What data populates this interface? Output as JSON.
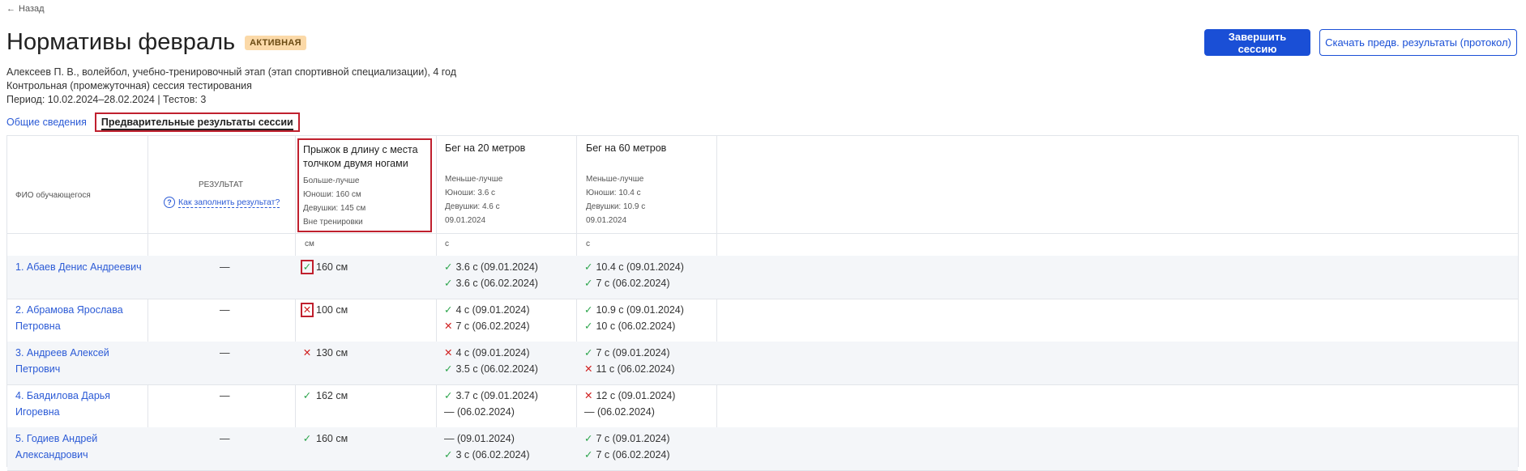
{
  "back": {
    "label": "Назад",
    "icon": "arrow-left-icon"
  },
  "page": {
    "title": "Нормативы февраль",
    "status": "АКТИВНАЯ"
  },
  "actions": {
    "finish": "Завершить сессию",
    "download": "Скачать предв. результаты (протокол)"
  },
  "info": {
    "line1": "Алексеев П. В., волейбол, учебно-тренировочный этап (этап спортивной специализации), 4 год",
    "line2": "Контрольная (промежуточная) сессия тестирования",
    "line3": "Период: 10.02.2024–28.02.2024 | Тестов: 3"
  },
  "tabs": {
    "general": "Общие сведения",
    "results": "Предварительные результаты сессии"
  },
  "table": {
    "col_name": "ФИО обучающегося",
    "col_result": "РЕЗУЛЬТАТ",
    "how_fill": "Как заполнить результат?",
    "tests": [
      {
        "title1": "Прыжок в длину с места",
        "title2": "толчком двумя ногами",
        "rule": "Больше-лучше",
        "boys": "Юноши: 160 см",
        "girls": "Девушки: 145 см",
        "extra": "Вне тренировки",
        "unit": "см"
      },
      {
        "title1": "Бег на 20 метров",
        "title2": "",
        "rule": "Меньше-лучше",
        "boys": "Юноши: 3.6 с",
        "girls": "Девушки: 4.6 с",
        "extra": "09.01.2024",
        "unit": "с"
      },
      {
        "title1": "Бег на 60 метров",
        "title2": "",
        "rule": "Меньше-лучше",
        "boys": "Юноши: 10.4 с",
        "girls": "Девушки: 10.9 с",
        "extra": "09.01.2024",
        "unit": "с"
      }
    ],
    "rows": [
      {
        "name1": "1. Абаев Денис Андреевич",
        "name2": "",
        "result": "—",
        "t1": "160 см",
        "t1_ok": true,
        "t2a": "3.6 с (09.01.2024)",
        "t2a_s": "ok",
        "t2b": "3.6 с (06.02.2024)",
        "t2b_s": "ok",
        "t3a": "10.4 с (09.01.2024)",
        "t3a_s": "ok",
        "t3b": "7 с (06.02.2024)",
        "t3b_s": "ok"
      },
      {
        "name1": "2. Абрамова Ярослава",
        "name2": "Петровна",
        "result": "—",
        "t1": "100 см",
        "t1_ok": false,
        "t2a": "4 с (09.01.2024)",
        "t2a_s": "ok",
        "t2b": "7 с (06.02.2024)",
        "t2b_s": "bad",
        "t3a": "10.9 с (09.01.2024)",
        "t3a_s": "ok",
        "t3b": "10 с (06.02.2024)",
        "t3b_s": "ok"
      },
      {
        "name1": "3. Андреев Алексей",
        "name2": "Петрович",
        "result": "—",
        "t1": "130 см",
        "t1_ok": false,
        "t2a": "4 с (09.01.2024)",
        "t2a_s": "bad",
        "t2b": "3.5 с (06.02.2024)",
        "t2b_s": "ok",
        "t3a": "7 с (09.01.2024)",
        "t3a_s": "ok",
        "t3b": "11 с (06.02.2024)",
        "t3b_s": "bad"
      },
      {
        "name1": "4. Баядилова Дарья",
        "name2": "Игоревна",
        "result": "—",
        "t1": "162 см",
        "t1_ok": true,
        "t2a": "3.7 с (09.01.2024)",
        "t2a_s": "ok",
        "t2b": "— (06.02.2024)",
        "t2b_s": "none",
        "t3a": "12 с (09.01.2024)",
        "t3a_s": "bad",
        "t3b": "— (06.02.2024)",
        "t3b_s": "none"
      },
      {
        "name1": "5. Годиев Андрей",
        "name2": "Александрович",
        "result": "—",
        "t1": "160 см",
        "t1_ok": true,
        "t2a": "— (09.01.2024)",
        "t2a_s": "none",
        "t2b": "3 с (06.02.2024)",
        "t2b_s": "ok",
        "t3a": "7 с (09.01.2024)",
        "t3a_s": "ok",
        "t3b": "7 с (06.02.2024)",
        "t3b_s": "ok"
      }
    ]
  },
  "colors": {
    "accent": "#1a4fd6",
    "ok": "#2aa44a",
    "bad": "#d02020",
    "highlight": "#c0202e",
    "badge_bg": "#fbd9a8"
  }
}
